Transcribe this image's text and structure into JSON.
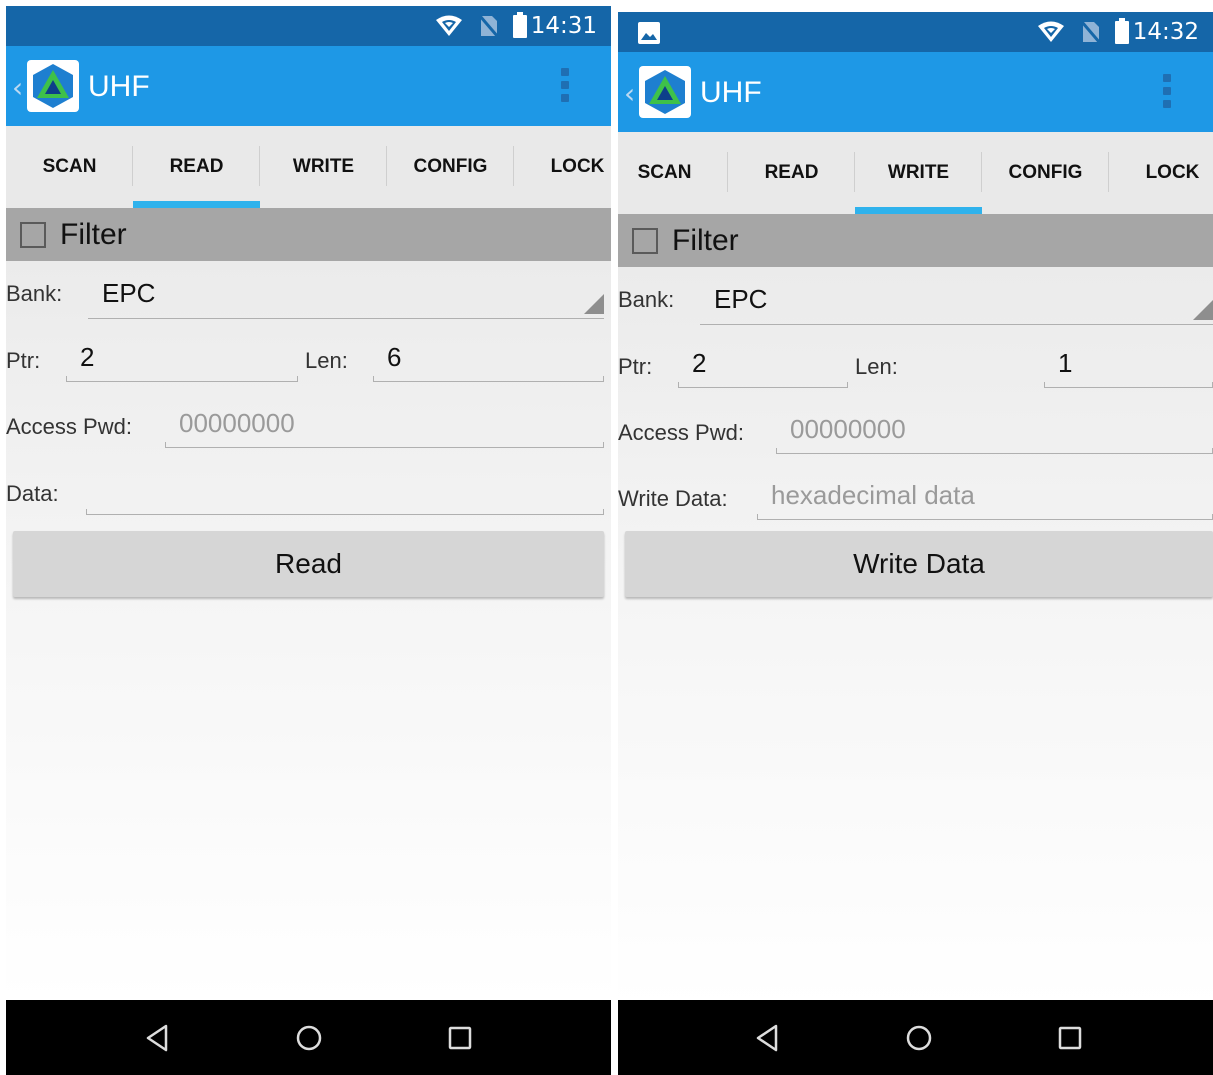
{
  "screens": [
    {
      "status": {
        "time": "14:31"
      },
      "app_bar": {
        "title": "UHF"
      },
      "tabs": [
        {
          "label": "SCAN"
        },
        {
          "label": "READ"
        },
        {
          "label": "WRITE"
        },
        {
          "label": "CONFIG"
        },
        {
          "label": "LOCK"
        }
      ],
      "active_tab": "READ",
      "filter": {
        "label": "Filter",
        "checked": false
      },
      "form": {
        "bank_label": "Bank:",
        "bank_value": "EPC",
        "ptr_label": "Ptr:",
        "ptr_value": "2",
        "len_label": "Len:",
        "len_value": "6",
        "pwd_label": "Access Pwd:",
        "pwd_placeholder": "00000000",
        "data_label": "Data:",
        "data_value": ""
      },
      "button_label": "Read"
    },
    {
      "status": {
        "time": "14:32"
      },
      "app_bar": {
        "title": "UHF"
      },
      "tabs": [
        {
          "label": "SCAN"
        },
        {
          "label": "READ"
        },
        {
          "label": "WRITE"
        },
        {
          "label": "CONFIG"
        },
        {
          "label": "LOCK"
        }
      ],
      "active_tab": "WRITE",
      "filter": {
        "label": "Filter",
        "checked": false
      },
      "form": {
        "bank_label": "Bank:",
        "bank_value": "EPC",
        "ptr_label": "Ptr:",
        "ptr_value": "2",
        "len_label": "Len:",
        "len_value": "1",
        "pwd_label": "Access Pwd:",
        "pwd_placeholder": "00000000",
        "data_label": "Write Data:",
        "data_placeholder": "hexadecimal data"
      },
      "button_label": "Write Data"
    }
  ],
  "colors": {
    "status_bar": "#1566a8",
    "app_bar": "#1e98e6",
    "tab_indicator": "#2fb2ec",
    "filter_bar": "#a6a6a6",
    "button": "#d6d6d6"
  },
  "icons": [
    "wifi-icon",
    "no-sim-icon",
    "battery-icon",
    "image-notification-icon",
    "app-logo-icon",
    "overflow-menu-icon",
    "nav-back-icon",
    "nav-home-icon",
    "nav-recents-icon"
  ]
}
